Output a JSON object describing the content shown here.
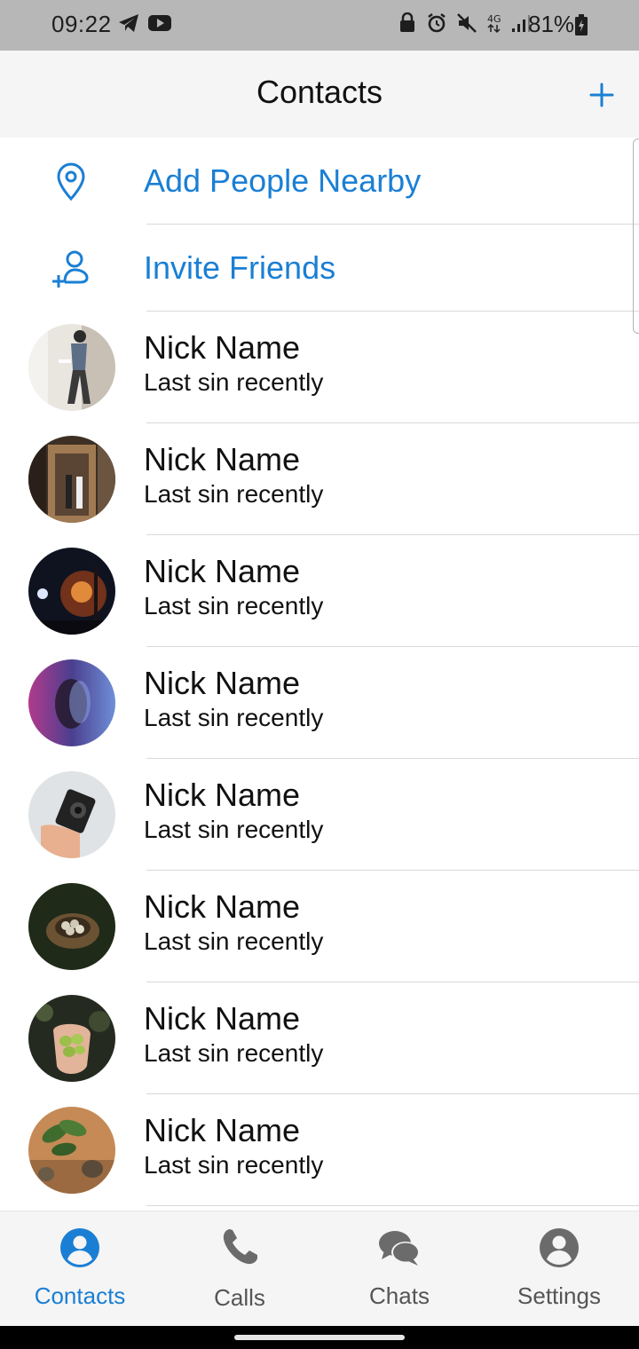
{
  "status_bar": {
    "time": "09:22",
    "left_icons": [
      "telegram-icon",
      "youtube-icon"
    ],
    "right_icons": [
      "lock-icon",
      "alarm-icon",
      "mute-icon",
      "4g-icon",
      "signal-icon"
    ],
    "battery_text": "81%"
  },
  "header": {
    "title": "Contacts",
    "add_icon": "plus-icon"
  },
  "actions": [
    {
      "label": "Add People Nearby",
      "icon": "location-pin-icon"
    },
    {
      "label": "Invite Friends",
      "icon": "add-person-icon"
    }
  ],
  "contacts": [
    {
      "name": "Nick Name",
      "status": "Last sin recently"
    },
    {
      "name": "Nick Name",
      "status": "Last sin recently"
    },
    {
      "name": "Nick Name",
      "status": "Last sin recently"
    },
    {
      "name": "Nick Name",
      "status": "Last sin recently"
    },
    {
      "name": "Nick Name",
      "status": "Last sin recently"
    },
    {
      "name": "Nick Name",
      "status": "Last sin recently"
    },
    {
      "name": "Nick Name",
      "status": "Last sin recently"
    },
    {
      "name": "Nick Name",
      "status": "Last sin recently"
    }
  ],
  "tabs": [
    {
      "label": "Contacts",
      "icon": "person-circle-icon",
      "active": true
    },
    {
      "label": "Calls",
      "icon": "phone-icon",
      "active": false
    },
    {
      "label": "Chats",
      "icon": "chat-bubbles-icon",
      "active": false
    },
    {
      "label": "Settings",
      "icon": "person-circle-icon",
      "active": false
    }
  ],
  "colors": {
    "accent": "#1a7fd4",
    "status_bar_bg": "#b7b7b7",
    "header_bg": "#f5f5f5",
    "tab_inactive": "#555555"
  }
}
